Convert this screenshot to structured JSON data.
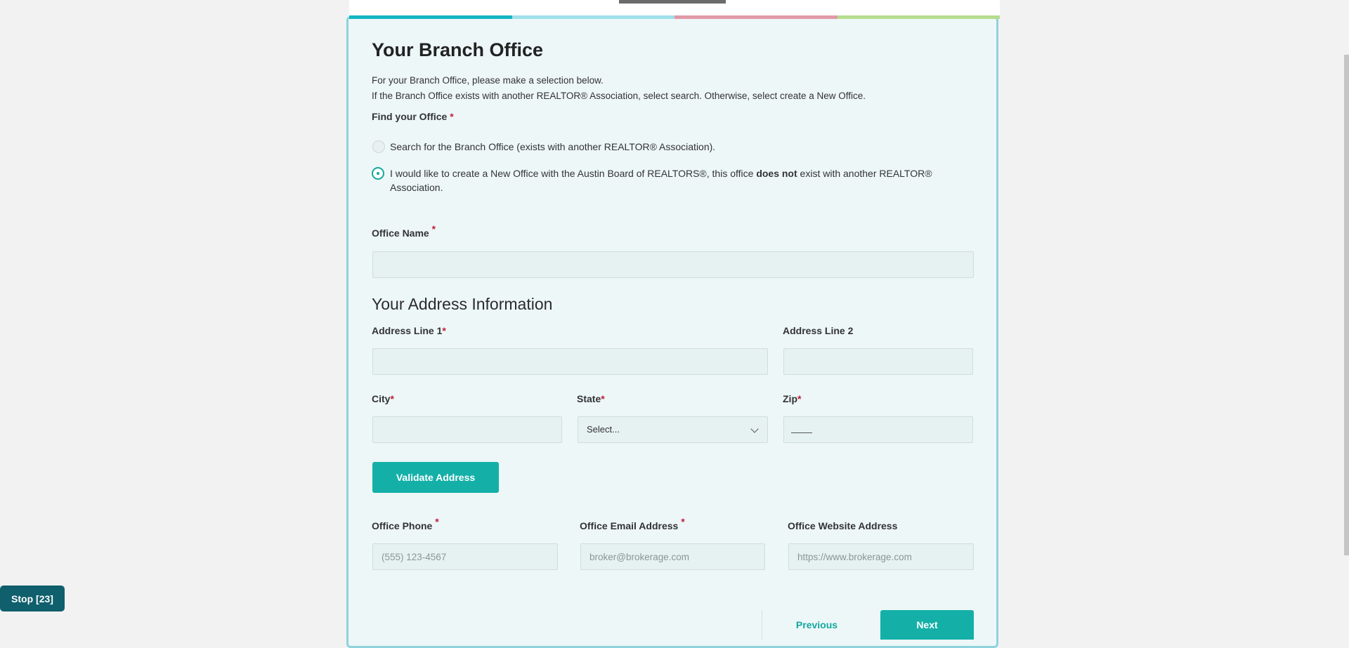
{
  "colors": {
    "accent": "#14b0a8",
    "progress": [
      "#14b6c2",
      "#9fe0ec",
      "#e09aa6",
      "#b6dd8e"
    ],
    "required": "#c0203a",
    "stop_button": "#0f5f6c"
  },
  "page": {
    "title": "Your Branch Office",
    "instruction_1": "For your Branch Office, please make a selection below.",
    "instruction_2": "If the Branch Office exists with another REALTOR® Association, select search. Otherwise, select create a New Office."
  },
  "find_office": {
    "label": "Find your Office",
    "required_mark": "*",
    "options": [
      {
        "label": "Search for the Branch Office (exists with another REALTOR® Association).",
        "selected": false
      },
      {
        "label_before": "I would like to create a New Office with the Austin Board of REALTORS®, this office ",
        "label_bold": "does not",
        "label_after": " exist with another REALTOR® Association.",
        "selected": true
      }
    ]
  },
  "office_name": {
    "label": "Office Name",
    "required_mark": "*",
    "value": ""
  },
  "address": {
    "section_title": "Your Address Information",
    "line1": {
      "label": "Address Line 1",
      "required_mark": "*",
      "value": ""
    },
    "line2": {
      "label": "Address Line 2",
      "value": ""
    },
    "city": {
      "label": "City",
      "required_mark": "*",
      "value": ""
    },
    "state": {
      "label": "State",
      "required_mark": "*",
      "selected": "Select..."
    },
    "zip": {
      "label": "Zip",
      "required_mark": "*",
      "value": ""
    },
    "validate_button": "Validate Address"
  },
  "contact": {
    "phone": {
      "label": "Office Phone",
      "required_mark": "*",
      "placeholder": "(555) 123-4567"
    },
    "email": {
      "label": "Office Email Address",
      "required_mark": "*",
      "placeholder": "broker@brokerage.com"
    },
    "website": {
      "label": "Office Website Address",
      "placeholder": "https://www.brokerage.com"
    }
  },
  "nav": {
    "previous": "Previous",
    "next": "Next"
  },
  "stop_button": "Stop [23]"
}
